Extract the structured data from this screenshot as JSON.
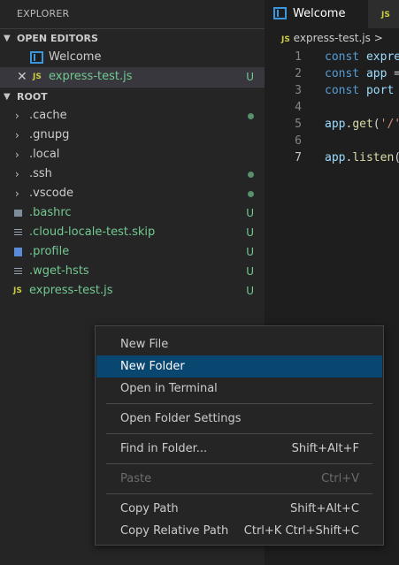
{
  "sidebar": {
    "title": "EXPLORER",
    "open_editors": {
      "header": "OPEN EDITORS",
      "items": [
        {
          "name": "Welcome",
          "icon": "welcome-icon"
        },
        {
          "name": "express-test.js",
          "icon": "js-icon",
          "badge": "U",
          "selected": true
        }
      ]
    },
    "root": {
      "header": "ROOT",
      "items": [
        {
          "name": ".cache",
          "type": "folder",
          "status": "dot"
        },
        {
          "name": ".gnupg",
          "type": "folder"
        },
        {
          "name": ".local",
          "type": "folder"
        },
        {
          "name": ".ssh",
          "type": "folder",
          "status": "dot"
        },
        {
          "name": ".vscode",
          "type": "folder",
          "status": "dot"
        },
        {
          "name": ".bashrc",
          "type": "file",
          "badge": "U"
        },
        {
          "name": ".cloud-locale-test.skip",
          "type": "file",
          "badge": "U"
        },
        {
          "name": ".profile",
          "type": "file",
          "badge": "U"
        },
        {
          "name": ".wget-hsts",
          "type": "file",
          "badge": "U"
        },
        {
          "name": "express-test.js",
          "type": "js",
          "badge": "U"
        }
      ]
    }
  },
  "editor": {
    "tabs": [
      {
        "label": "Welcome",
        "active": true
      },
      {
        "label": "JS",
        "active": false
      }
    ],
    "breadcrumb": {
      "js_tag": "JS",
      "file": "express-test.js",
      "sep": ">"
    },
    "lines": [
      {
        "num": "1",
        "tokens": [
          [
            "kw",
            "const "
          ],
          [
            "vr",
            "expre"
          ]
        ]
      },
      {
        "num": "2",
        "tokens": [
          [
            "kw",
            "const "
          ],
          [
            "vr",
            "app "
          ],
          [
            "pn",
            "="
          ]
        ]
      },
      {
        "num": "3",
        "tokens": [
          [
            "kw",
            "const "
          ],
          [
            "vr",
            "port "
          ]
        ]
      },
      {
        "num": "4",
        "tokens": []
      },
      {
        "num": "5",
        "tokens": [
          [
            "vr",
            "app"
          ],
          [
            "pn",
            "."
          ],
          [
            "fn",
            "get"
          ],
          [
            "pn",
            "("
          ],
          [
            "st",
            "'/'"
          ]
        ]
      },
      {
        "num": "6",
        "tokens": []
      },
      {
        "num": "7",
        "tokens": [
          [
            "vr",
            "app"
          ],
          [
            "pn",
            "."
          ],
          [
            "fn",
            "listen"
          ],
          [
            "pn",
            "("
          ]
        ],
        "current": true
      }
    ]
  },
  "context_menu": {
    "groups": [
      [
        {
          "label": "New File",
          "shortcut": ""
        },
        {
          "label": "New Folder",
          "shortcut": "",
          "highlighted": true
        },
        {
          "label": "Open in Terminal",
          "shortcut": ""
        }
      ],
      [
        {
          "label": "Open Folder Settings",
          "shortcut": ""
        }
      ],
      [
        {
          "label": "Find in Folder...",
          "shortcut": "Shift+Alt+F"
        }
      ],
      [
        {
          "label": "Paste",
          "shortcut": "Ctrl+V",
          "disabled": true
        }
      ],
      [
        {
          "label": "Copy Path",
          "shortcut": "Shift+Alt+C"
        },
        {
          "label": "Copy Relative Path",
          "shortcut": "Ctrl+K Ctrl+Shift+C"
        }
      ]
    ]
  },
  "colors": {
    "sidebar_bg": "#252526",
    "editor_bg": "#1e1e1e",
    "menu_highlight": "#094771",
    "git_untracked": "#73c991",
    "js_icon": "#cbcb41"
  }
}
